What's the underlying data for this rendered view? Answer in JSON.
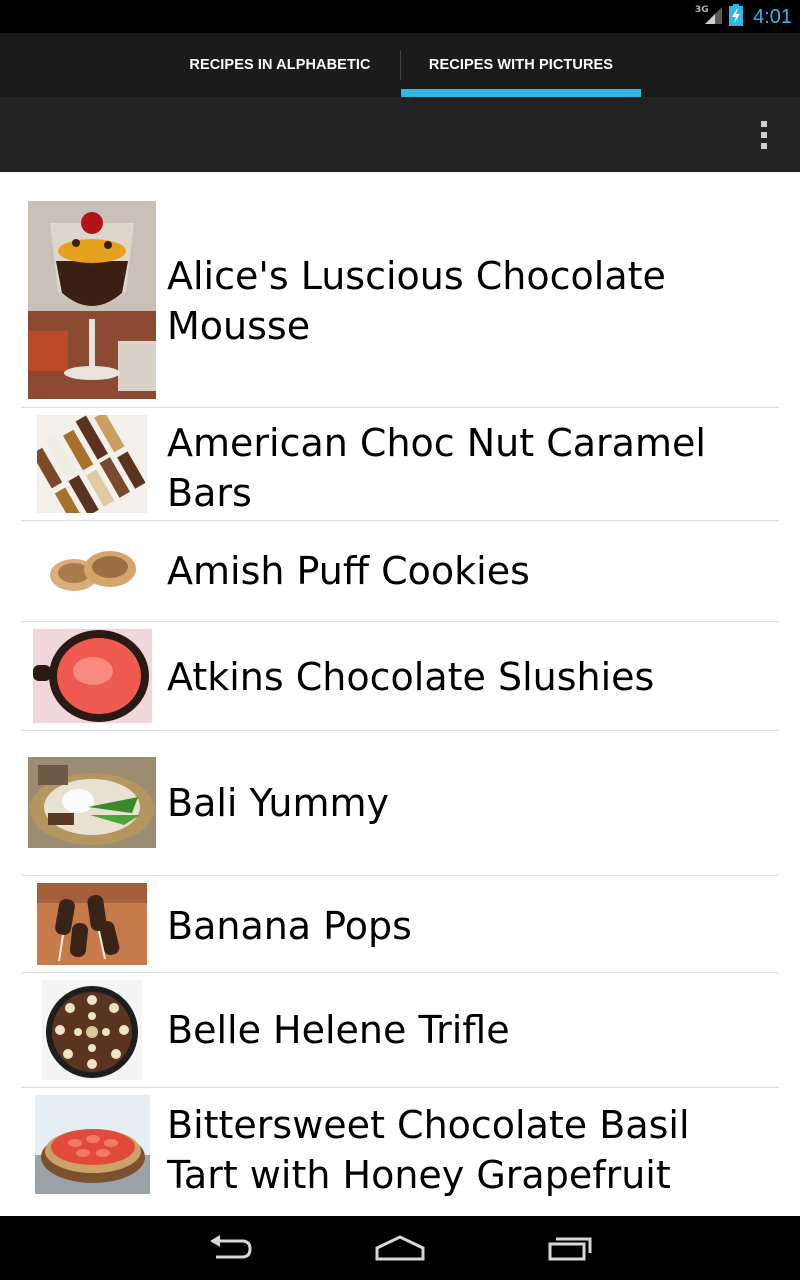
{
  "status_bar": {
    "network": "3G",
    "time": "4:01",
    "icons": [
      "signal-icon",
      "battery-charging-icon"
    ]
  },
  "tabs": [
    {
      "label": "RECIPES IN ALPHABETIC",
      "selected": false
    },
    {
      "label": "RECIPES WITH PICTURES",
      "selected": true
    }
  ],
  "action_bar": {
    "icons": [
      "overflow-menu-icon"
    ]
  },
  "recipes": [
    {
      "title": "Alice's Luscious Chocolate Mousse",
      "image": "chocolate-mousse-photo"
    },
    {
      "title": "American Choc Nut Caramel Bars",
      "image": "caramel-bars-photo"
    },
    {
      "title": "Amish Puff Cookies",
      "image": "puff-cookies-photo"
    },
    {
      "title": "Atkins Chocolate Slushies",
      "image": "slushie-photo"
    },
    {
      "title": "Bali Yummy",
      "image": "bali-dish-photo"
    },
    {
      "title": "Banana Pops",
      "image": "banana-pops-photo"
    },
    {
      "title": "Belle Helene Trifle",
      "image": "trifle-photo"
    },
    {
      "title": "Bittersweet Chocolate Basil Tart with Honey Grapefruit",
      "image": "grapefruit-tart-photo"
    }
  ],
  "nav_bar": {
    "icons": [
      "back-icon",
      "home-icon",
      "recent-apps-icon"
    ]
  },
  "colors": {
    "accent": "#33b5e5",
    "tab_bar": "#1b1b1b",
    "action_bar": "#222222",
    "divider": "#dedede"
  }
}
